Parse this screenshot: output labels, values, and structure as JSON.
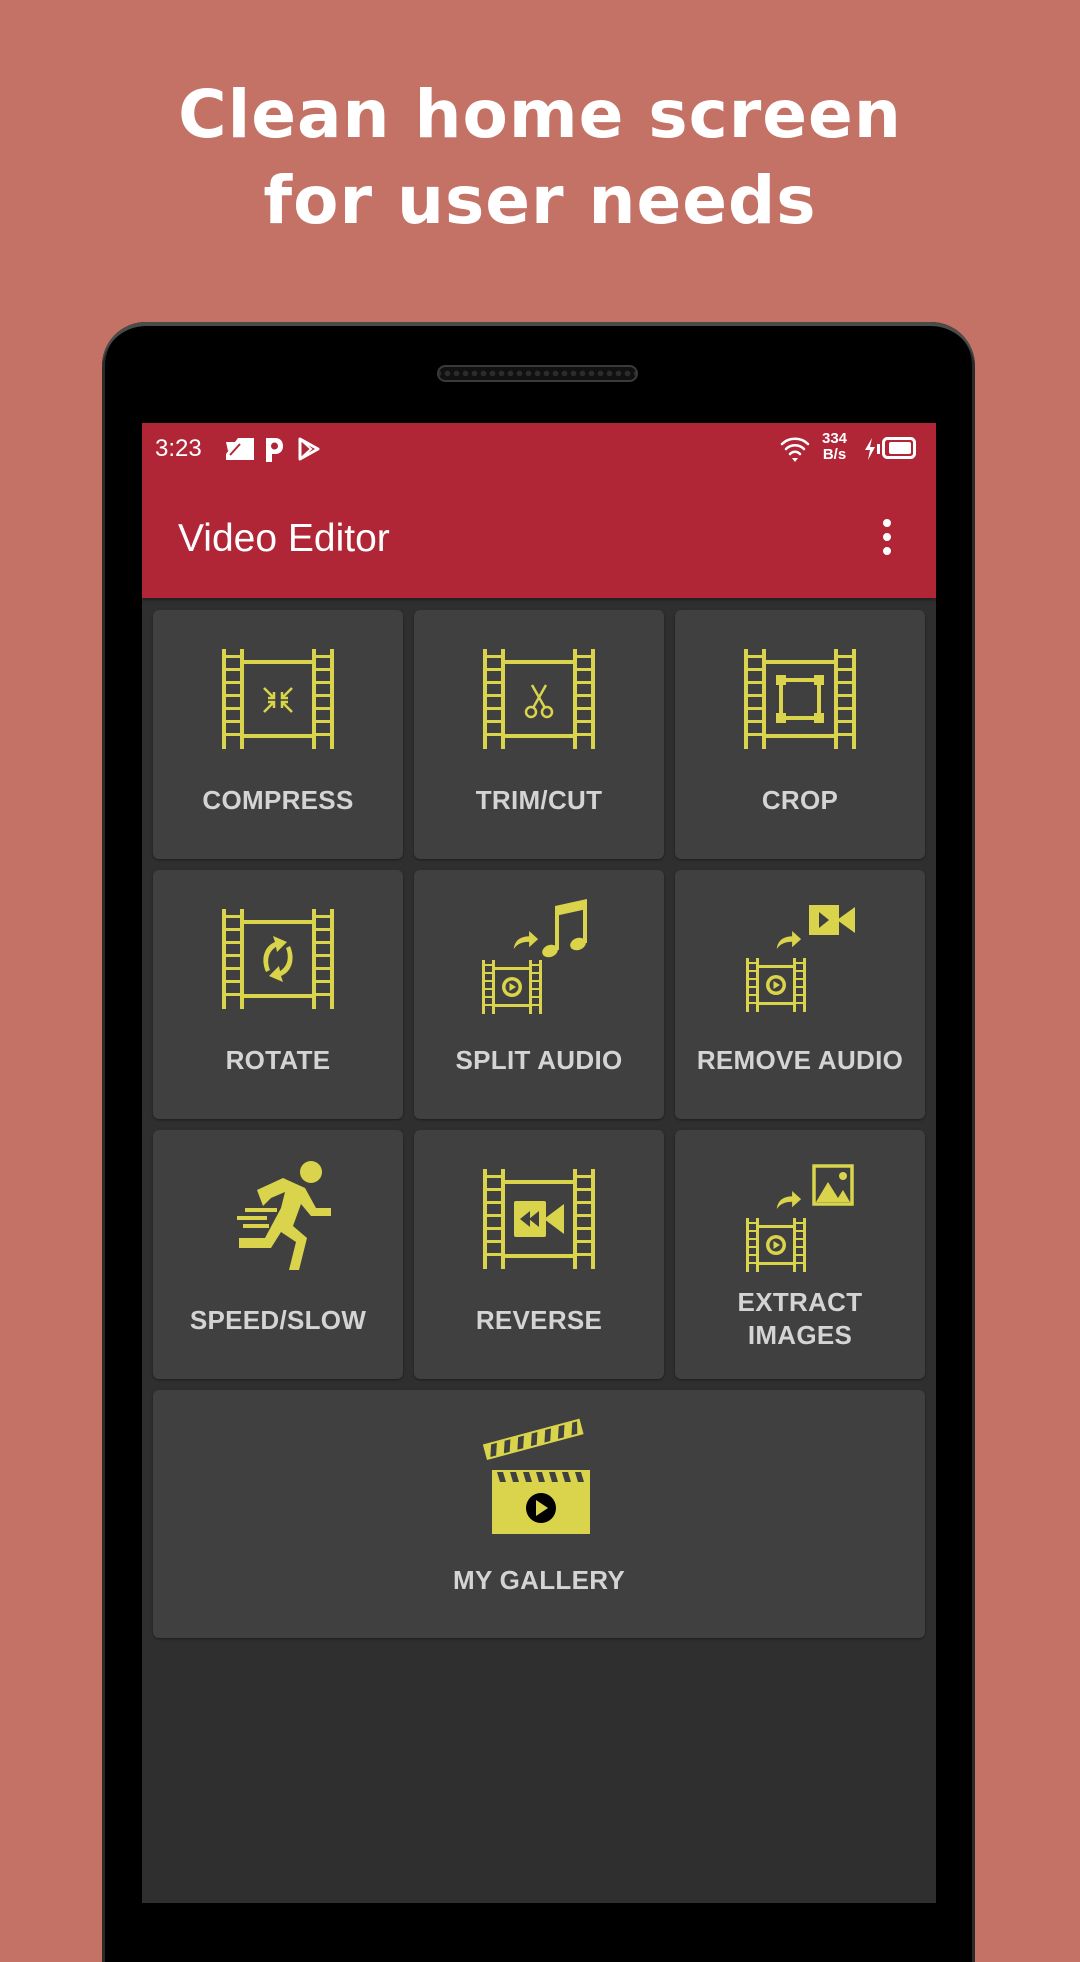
{
  "promo": {
    "headline_line1": "Clean home screen",
    "headline_line2": "for user needs",
    "background_color": "#c47266"
  },
  "status_bar": {
    "time": "3:23",
    "notification_icons": [
      "message-icon",
      "parking-icon",
      "play-store-icon"
    ],
    "net_speed_value": "334",
    "net_speed_unit": "B/s",
    "system_icons": [
      "wifi-icon",
      "charging-icon",
      "battery-icon"
    ]
  },
  "app_bar": {
    "title": "Video Editor",
    "menu_icon": "more-vert-icon",
    "color": "#b12636"
  },
  "theme": {
    "icon_color": "#d9d44b",
    "tile_color": "#404040",
    "screen_bg": "#2f2f2f",
    "label_color": "#d4d4d4"
  },
  "tools": [
    {
      "id": "compress",
      "label": "COMPRESS",
      "icon": "compress-video-icon"
    },
    {
      "id": "trim",
      "label": "TRIM/CUT",
      "icon": "trim-video-icon"
    },
    {
      "id": "crop",
      "label": "CROP",
      "icon": "crop-video-icon"
    },
    {
      "id": "rotate",
      "label": "ROTATE",
      "icon": "rotate-video-icon"
    },
    {
      "id": "split-audio",
      "label": "SPLIT AUDIO",
      "icon": "split-audio-icon"
    },
    {
      "id": "remove-audio",
      "label": "REMOVE AUDIO",
      "icon": "remove-audio-icon"
    },
    {
      "id": "speed",
      "label": "SPEED/SLOW",
      "icon": "running-person-icon"
    },
    {
      "id": "reverse",
      "label": "REVERSE",
      "icon": "reverse-video-icon"
    },
    {
      "id": "extract-images",
      "label_line1": "EXTRACT",
      "label_line2": "IMAGES",
      "icon": "extract-images-icon"
    }
  ],
  "gallery": {
    "label": "MY GALLERY",
    "icon": "clapperboard-icon"
  }
}
